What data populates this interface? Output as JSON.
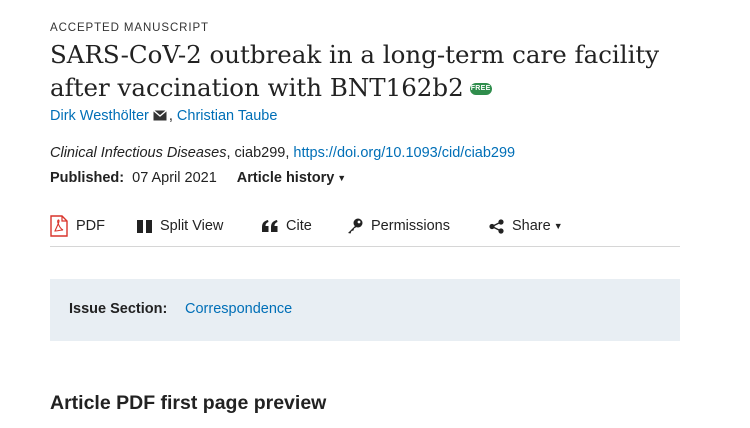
{
  "article": {
    "kicker": "ACCEPTED MANUSCRIPT",
    "title": "SARS-CoV-2 outbreak in a long-term care facility after vaccination with BNT162b2",
    "free_badge": "FREE",
    "authors": [
      "Dirk Westhölter",
      "Christian Taube"
    ],
    "author_separator": ",",
    "journal": "Clinical Infectious Diseases",
    "article_id": ", ciab299, ",
    "doi": "https://doi.org/10.1093/cid/ciab299",
    "published_label": "Published:",
    "published_date": "07 April 2021",
    "history_label": "Article history",
    "caret": "▼"
  },
  "toolbar": {
    "pdf": "PDF",
    "split_view": "Split View",
    "cite": "Cite",
    "permissions": "Permissions",
    "share": "Share",
    "share_caret": "▼"
  },
  "issue_section": {
    "label": "Issue Section:",
    "value": "Correspondence"
  },
  "preview": {
    "heading": "Article PDF first page preview"
  },
  "colors": {
    "link": "#006fb7",
    "badge": "#2f8d4c",
    "pdf_icon": "#d9342b",
    "issue_bg": "#e8eef3"
  },
  "icons": [
    "mail-icon",
    "pdf-icon",
    "split-view-icon",
    "quote-icon",
    "key-icon",
    "share-icon"
  ]
}
